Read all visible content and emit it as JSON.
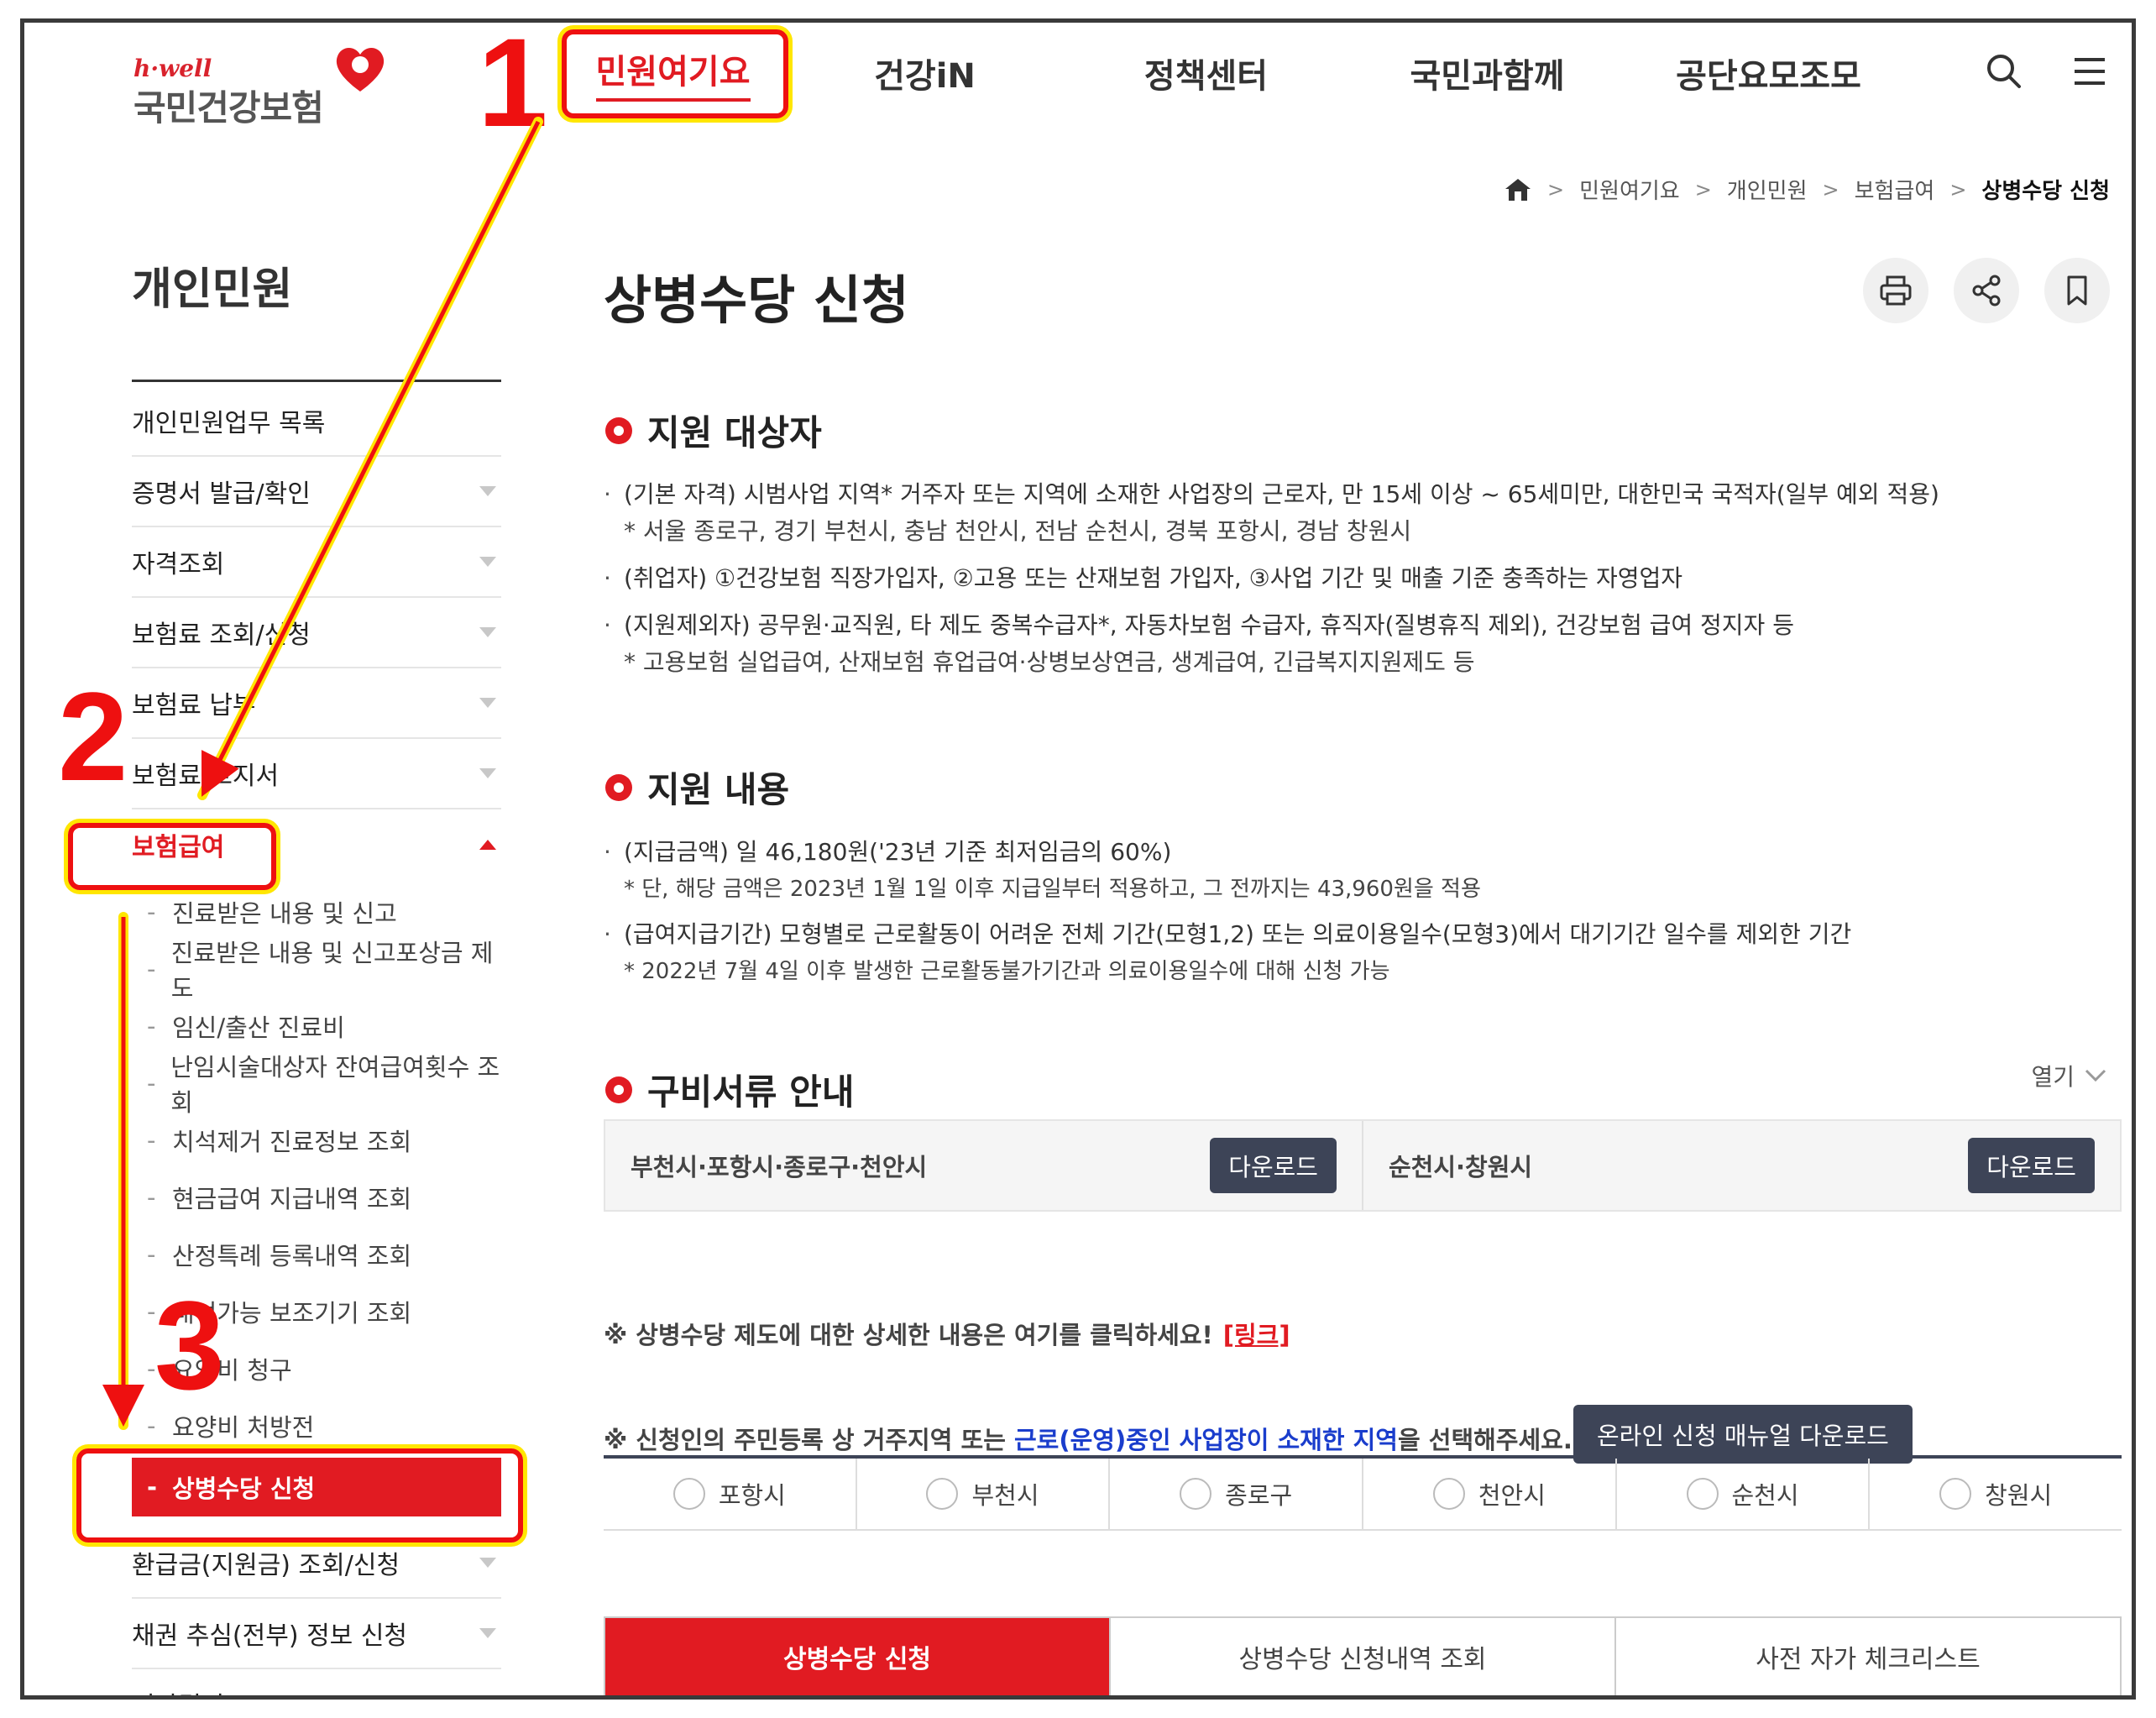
{
  "logo": {
    "tagline": "h·well",
    "name": "국민건강보험"
  },
  "gnb": [
    {
      "label": "민원여기요",
      "active": true
    },
    {
      "label": "건강iN",
      "active": false
    },
    {
      "label": "정책센터",
      "active": false
    },
    {
      "label": "국민과함께",
      "active": false
    },
    {
      "label": "공단요모조모",
      "active": false
    }
  ],
  "header_icons": [
    "search-icon",
    "menu-icon"
  ],
  "breadcrumb": [
    "민원여기요",
    "개인민원",
    "보험급여",
    "상병수당 신청"
  ],
  "sidebar": {
    "title": "개인민원",
    "items": [
      {
        "label": "개인민원업무 목록"
      },
      {
        "label": "증명서 발급/확인"
      },
      {
        "label": "자격조회"
      },
      {
        "label": "보험료 조회/신청"
      },
      {
        "label": "보험료 납부"
      },
      {
        "label": "보험료 고지서"
      },
      {
        "label": "보험급여"
      }
    ],
    "sub_items": [
      "진료받은 내용 및 신고",
      "진료받은 내용 및 신고포상금 제도",
      "임신/출산 진료비",
      "난임시술대상자 잔여급여횟수 조회",
      "치석제거 진료정보 조회",
      "현금급여 지급내역 조회",
      "산정특례 등록내역 조회",
      "내여가능 보조기기 조회",
      "요양비 청구",
      "요양비 처방전",
      "상병수당 신청"
    ],
    "items_after": [
      {
        "label": "환급금(지원금) 조회/신청"
      },
      {
        "label": "채권 추심(전부) 정보 신청"
      },
      {
        "label": "건강검진"
      }
    ]
  },
  "page": {
    "title": "상병수당 신청",
    "tools": [
      "print-icon",
      "share-icon",
      "bookmark-icon"
    ]
  },
  "section1": {
    "title": "지원 대상자",
    "b1": "(기본 자격) 시범사업 지역* 거주자 또는 지역에 소재한 사업장의 근로자, 만 15세 이상 ~ 65세미만, 대한민국 국적자(일부 예외 적용)",
    "n1": "* 서울 종로구, 경기 부천시, 충남 천안시, 전남 순천시, 경북 포항시, 경남 창원시",
    "b2": "(취업자) ①건강보험 직장가입자, ②고용 또는 산재보험 가입자, ③사업 기간 및 매출 기준 충족하는 자영업자",
    "b3": "(지원제외자) 공무원·교직원, 타 제도 중복수급자*, 자동차보험 수급자, 휴직자(질병휴직 제외), 건강보험 급여 정지자 등",
    "n3": "* 고용보험 실업급여, 산재보험 휴업급여·상병보상연금, 생계급여, 긴급복지지원제도 등"
  },
  "section2": {
    "title": "지원 내용",
    "b1": "(지급금액) 일 46,180원('23년 기준 최저임금의 60%)",
    "n1": "*  단, 해당 금액은 2023년 1월 1일 이후 지급일부터 적용하고, 그 전까지는 43,960원을 적용",
    "b2": "(급여지급기간) 모형별로 근로활동이 어려운 전체 기간(모형1,2) 또는 의료이용일수(모형3)에서 대기기간 일수를 제외한 기간",
    "n2": "*  2022년 7월 4일 이후 발생한 근로활동불가기간과 의료이용일수에 대해 신청 가능"
  },
  "section3": {
    "title": "구비서류 안내",
    "toggle": "열기",
    "cells": [
      {
        "label": "부천시·포항시·종로구·천안시",
        "button": "다운로드"
      },
      {
        "label": "순천시·창원시",
        "button": "다운로드"
      }
    ]
  },
  "notice1": {
    "text": "※ 상병수당 제도에 대한 상세한 내용은 여기를 클릭하세요!",
    "link": "[링크]"
  },
  "notice2": {
    "pre": "※ 신청인의 주민등록 상 거주지역 또는 ",
    "blue": "근로(운영)중인 사업장이 소재한 지역",
    "post": "을 선택해주세요.",
    "button": "온라인 신청 매뉴얼 다운로드"
  },
  "regions": [
    "포항시",
    "부천시",
    "종로구",
    "천안시",
    "순천시",
    "창원시"
  ],
  "bottom_tabs": [
    {
      "label": "상병수당 신청",
      "active": true
    },
    {
      "label": "상병수당 신청내역 조회",
      "active": false
    },
    {
      "label": "사전 자가 체크리스트",
      "active": false
    }
  ],
  "annotations": {
    "n1": "1",
    "n2": "2",
    "n3": "3"
  },
  "colors": {
    "brand_red": "#e11b22",
    "annotation_red": "#ee1010",
    "highlight_yellow": "#ffe600",
    "dark_button": "#3d4457",
    "link_blue": "#1a3dcc"
  }
}
